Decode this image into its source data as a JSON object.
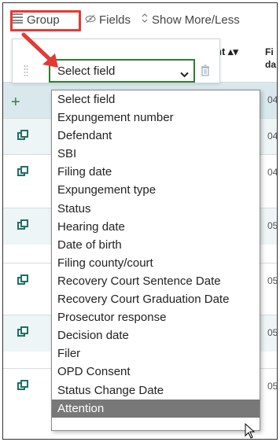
{
  "toolbar": {
    "group_label": "Group",
    "fields_label": "Fields",
    "more_label": "Show More/Less"
  },
  "table": {
    "sort_header_fragment": "nt",
    "sort_icon": "sort-arrows-icon",
    "filing_header": [
      "Fi",
      "da"
    ],
    "row_values": [
      "04",
      "04",
      "04",
      "05",
      "05",
      "05",
      "05"
    ]
  },
  "group_panel": {
    "select_value": "Select field"
  },
  "dropdown": {
    "options": [
      "Select field",
      "Expungement number",
      "Defendant",
      "SBI",
      "Filing date",
      "Expungement type",
      "Status",
      "Hearing date",
      "Date of birth",
      "Filing county/court",
      "Recovery Court Sentence Date",
      "Recovery Court Graduation Date",
      "Prosecutor response",
      "Decision date",
      "Filer",
      "OPD Consent",
      "Status Change Date",
      "Attention"
    ],
    "highlighted": "Attention"
  },
  "colors": {
    "annotation_red": "#e53935",
    "select_border": "#2e7d32",
    "highlight_row": "#787878",
    "teal_icon": "#1f6f66"
  }
}
